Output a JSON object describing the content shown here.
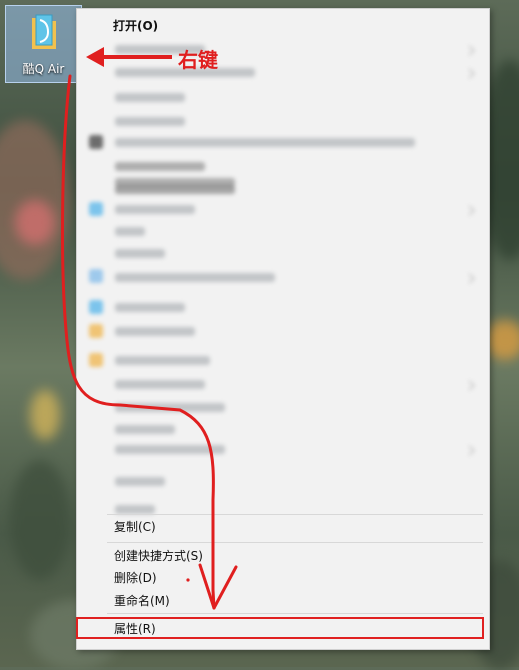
{
  "desktop": {
    "icon": {
      "label": "酷Q Air",
      "icon_name": "folder-document-icon"
    }
  },
  "context_menu": {
    "open_label": "打开(O)",
    "copy_label": "复制(C)",
    "create_shortcut_label": "创建快捷方式(S)",
    "delete_label": "删除(D)",
    "rename_label": "重命名(M)",
    "properties_label": "属性(R)"
  },
  "annotation": {
    "text": "右键",
    "color": "#e01f1f"
  }
}
